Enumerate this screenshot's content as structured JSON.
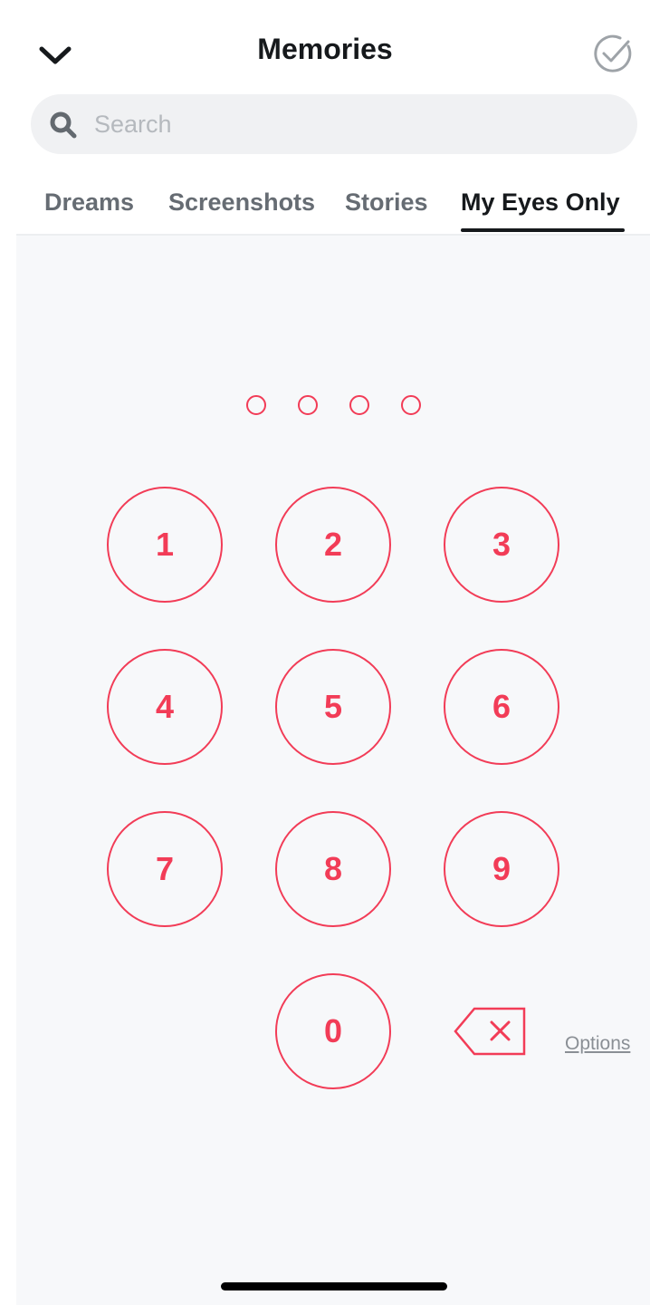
{
  "header": {
    "title": "Memories",
    "back_icon": "chevron-down-icon",
    "select_icon": "check-circle-icon"
  },
  "search": {
    "placeholder": "Search",
    "value": "",
    "icon": "search-icon"
  },
  "tabs": [
    {
      "label": "Dreams",
      "active": false
    },
    {
      "label": "Screenshots",
      "active": false
    },
    {
      "label": "Stories",
      "active": false
    },
    {
      "label": "My Eyes Only",
      "active": true
    }
  ],
  "passcode": {
    "digits_entered": 0,
    "digits_total": 4,
    "keys": [
      "1",
      "2",
      "3",
      "4",
      "5",
      "6",
      "7",
      "8",
      "9",
      "0"
    ],
    "delete_icon": "backspace-icon",
    "options_label": "Options"
  },
  "colors": {
    "accent": "#f23c57",
    "text_dark": "#16191c",
    "tab_inactive": "#666c73",
    "background": "#f7f8fa"
  }
}
